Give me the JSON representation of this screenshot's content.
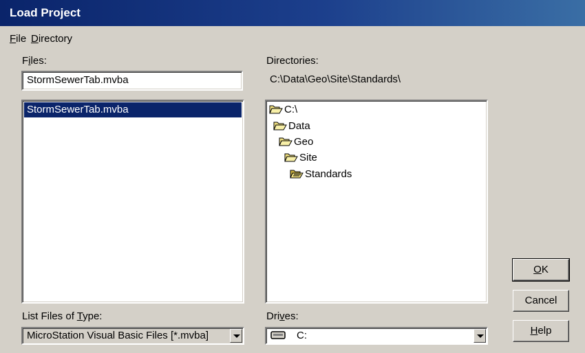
{
  "window": {
    "title": "Load Project"
  },
  "menu": {
    "file": {
      "mnemonic": "F",
      "rest": "ile"
    },
    "directory": {
      "mnemonic": "D",
      "rest": "irectory"
    }
  },
  "files": {
    "label_pre": "F",
    "label_mnemonic": "i",
    "label_post": "les:",
    "filename_value": "StormSewerTab.mvba",
    "list": [
      "StormSewerTab.mvba"
    ],
    "selected": "StormSewerTab.mvba"
  },
  "directories": {
    "label": "Directories:",
    "current_path": "C:\\Data\\Geo\\Site\\Standards\\",
    "tree": [
      {
        "name": "C:\\",
        "icon": "open-folder-icon"
      },
      {
        "name": "Data",
        "icon": "open-folder-icon"
      },
      {
        "name": "Geo",
        "icon": "open-folder-icon"
      },
      {
        "name": "Site",
        "icon": "open-folder-icon"
      },
      {
        "name": "Standards",
        "icon": "current-folder-icon"
      }
    ]
  },
  "file_type": {
    "label_pre": "List Files of ",
    "label_mnemonic": "T",
    "label_post": "ype:",
    "value": "MicroStation Visual Basic Files [*.mvba]"
  },
  "drives": {
    "label_pre": "Dri",
    "label_mnemonic": "v",
    "label_post": "es:",
    "value": "C:",
    "icon": "drive-icon"
  },
  "buttons": {
    "ok": {
      "mnemonic": "O",
      "rest": "K"
    },
    "cancel": {
      "label": "Cancel"
    },
    "help": {
      "mnemonic": "H",
      "rest": "elp"
    }
  },
  "colors": {
    "title_bar": "#0a246a",
    "selection": "#0a246a",
    "face": "#d4d0c8",
    "folder": "#f0e080"
  }
}
